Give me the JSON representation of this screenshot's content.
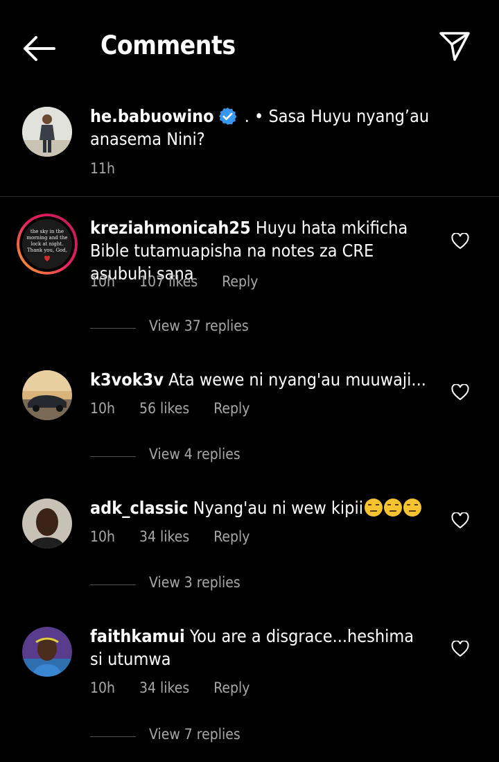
{
  "header": {
    "title": "Comments"
  },
  "caption": {
    "username": "he.babuowino",
    "text": " . • Sasa Huyu nyang’au anasema Nini?",
    "time": "11h"
  },
  "comments": [
    {
      "username": "kreziahmonicah25",
      "text": "Huyu hata mkificha Bible tutamuapisha na notes za CRE asubuhi sana",
      "time": "10h",
      "likes": "107 likes",
      "reply": "Reply",
      "view_replies": "View 37 replies"
    },
    {
      "username": "k3vok3v",
      "text": "Ata wewe ni nyang'au muuwaji...",
      "time": "10h",
      "likes": "56 likes",
      "reply": "Reply",
      "view_replies": "View 4 replies"
    },
    {
      "username": "adk_classic",
      "text": "Nyang'au ni wew kipii",
      "time": "10h",
      "likes": "34 likes",
      "reply": "Reply",
      "view_replies": "View 3 replies"
    },
    {
      "username": "faithkamui",
      "text": "You are a disgrace...heshima si utumwa",
      "time": "10h",
      "likes": "34 likes",
      "reply": "Reply",
      "view_replies": "View 7 replies"
    }
  ],
  "avatar_story_text": "the sky in the morning and the lock at night. Thank you, God, for everything.",
  "colors": {
    "background": "#000000",
    "text": "#ffffff",
    "secondary": "#a8a8a8",
    "verified": "#3897f0"
  }
}
